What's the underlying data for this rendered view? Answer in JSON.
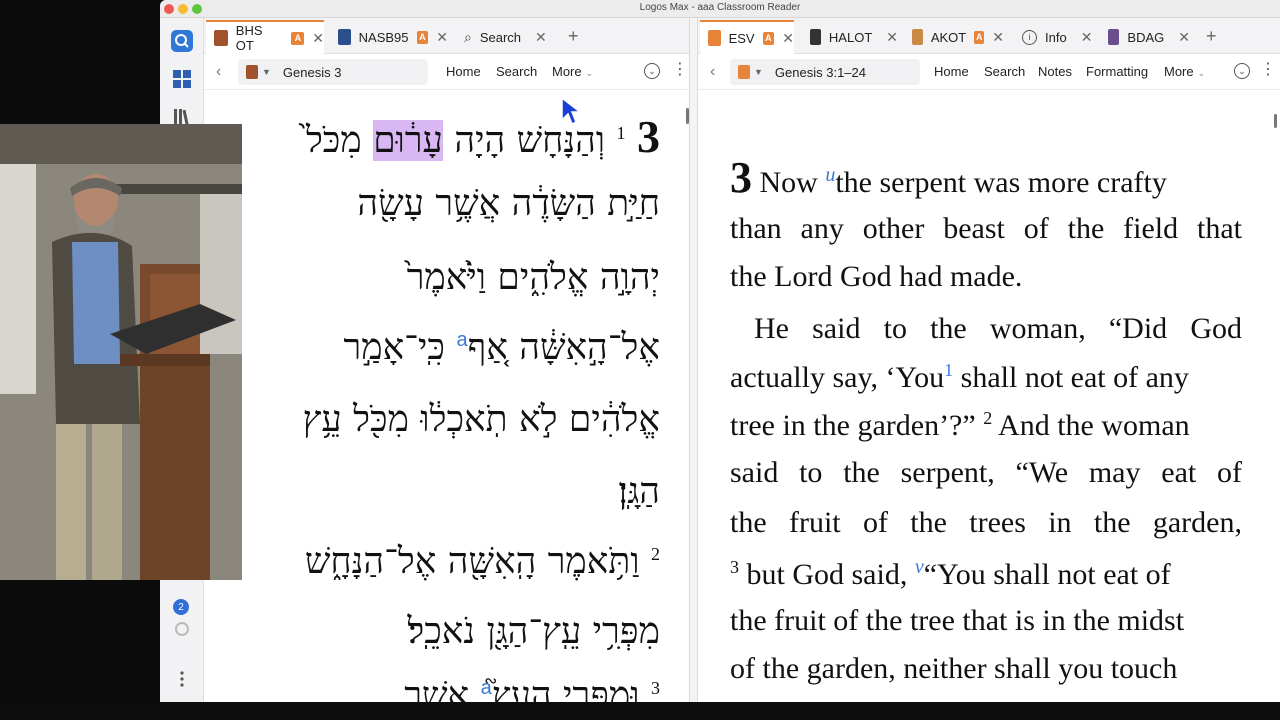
{
  "window": {
    "title": "Logos Max - aaa Classroom Reader"
  },
  "left_panel": {
    "tabs": [
      {
        "label": "BHS OT",
        "badge": "A",
        "active": true,
        "icon": "book-icon"
      },
      {
        "label": "NASB95",
        "badge": "A",
        "active": false,
        "icon": "book-icon"
      },
      {
        "label": "Search",
        "active": false,
        "icon": "search-icon"
      }
    ],
    "toolbar": {
      "reference": "Genesis 3",
      "links": [
        "Home",
        "Search",
        "More"
      ]
    },
    "hebrew": {
      "chapter": "3",
      "lines": [
        {
          "verse": "1",
          "pre": "וְהַנָּחָשׁ הָיָה ",
          "highlight": "עָר֔וּם",
          "post": " מִכֹּל֙"
        },
        {
          "text": "חַיַּ֣ת הַשָּׂדֶ֔ה אֲשֶׁ֥ר עָשָׂ֖ה"
        },
        {
          "text": "יְהוָ֣ה אֱלֹהִ֑ים וַיֹּ֙אמֶר֙"
        },
        {
          "pre": "אֶל־הָ֣אִשָּׁ֔ה אַ֚ף",
          "fn": "a",
          "post": " כִּֽי־אָמַ֣ר"
        },
        {
          "text": "אֱלֹהִ֔ים לֹ֣א תֹֽאכְל֔וּ מִכֹּ֖ל עֵ֥ץ"
        },
        {
          "text": "הַגָּֽן׃"
        },
        {
          "verse": "2",
          "text": "וַתֹּ֥אמֶר הָֽאִשָּׁ֖ה אֶל־הַנָּחָ֑שׁ"
        },
        {
          "text": "מִפְּרִ֥י עֵֽץ־הַגָּ֖ן נֹאכֵֽל׃"
        },
        {
          "verse": "3",
          "pre": "וּמִפְּרִ֣י הָעֵץ֮",
          "fn": "a",
          "post": " אֲשֶׁ֣ר"
        }
      ]
    }
  },
  "right_panel": {
    "tabs": [
      {
        "label": "ESV",
        "badge": "A",
        "active": true,
        "icon": "book-icon"
      },
      {
        "label": "HALOT",
        "active": false,
        "icon": "book-icon"
      },
      {
        "label": "AKOT",
        "badge": "A",
        "active": false,
        "icon": "book-icon"
      },
      {
        "label": "Info",
        "active": false,
        "icon": "info-icon"
      },
      {
        "label": "BDAG",
        "active": false,
        "icon": "book-icon"
      }
    ],
    "toolbar": {
      "reference": "Genesis 3:1–24",
      "links": [
        "Home",
        "Search",
        "Notes",
        "Formatting",
        "More"
      ]
    },
    "english": {
      "chapter": "3",
      "l1a": "Now ",
      "l1x": "u",
      "l1b": "the serpent was more crafty",
      "l2": "than any other beast of the field that",
      "l3": "the Lord God had made.",
      "l4": "He said to the woman, “Did God",
      "l5a": "actually say, ‘You",
      "l5n": "1",
      "l5b": " shall not eat of any",
      "l6a": "tree in the garden’?” ",
      "l6v": "2",
      "l6b": " And the woman",
      "l7": "said to the serpent, “We may eat of",
      "l8": "the fruit of the trees in the garden,",
      "l9v": "3",
      "l9a": " but God said, ",
      "l9x": "v",
      "l9b": "“You shall not eat of",
      "l10": "the fruit of the tree that is in the midst",
      "l11": "of the garden, neither shall you touch"
    }
  },
  "rail": {
    "badge": "2"
  },
  "colors": {
    "accent": "#e8833a",
    "highlight": "#d9b7f3",
    "link": "#3b78d4"
  }
}
